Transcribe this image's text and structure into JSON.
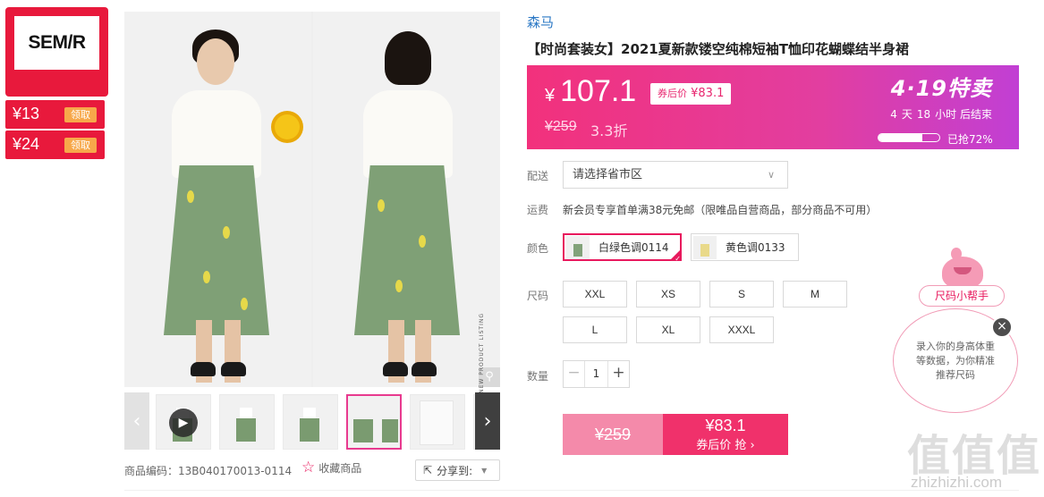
{
  "brand_box": {
    "logo_text": "SEM/R"
  },
  "coupons": [
    {
      "amount": "¥13",
      "action": "领取"
    },
    {
      "amount": "¥24",
      "action": "领取"
    }
  ],
  "gallery": {
    "vertical_watermark": "NEW PRODUCT LISTING",
    "zoom_icon": "magnifier-icon",
    "thumbnails": [
      {
        "kind": "video",
        "icon": "play-icon"
      },
      {
        "kind": "image"
      },
      {
        "kind": "image"
      },
      {
        "kind": "image",
        "active": true
      },
      {
        "kind": "image"
      },
      {
        "kind": "image"
      }
    ],
    "prev_icon": "chevron-left-icon",
    "next_icon": "chevron-right-icon"
  },
  "product": {
    "brand": "森马",
    "title": "【时尚套装女】2021夏新款镂空纯棉短袖T恤印花蝴蝶结半身裙",
    "sku_label": "商品编码：",
    "sku_value": "13B040170013-0114",
    "favorite_label": "收藏商品",
    "share_label": "分享到:"
  },
  "price": {
    "currency": "¥",
    "current": "107.1",
    "after_coupon_label": "券后价",
    "after_coupon_value": "¥83.1",
    "original": "¥259",
    "discount": "3.3折",
    "promo_name": "4·19特卖",
    "countdown": {
      "days": "4",
      "days_unit": "天",
      "hours": "18",
      "hours_unit": "小时",
      "suffix": "后结束"
    },
    "sold_percent": 72,
    "sold_text": "已抢72%",
    "accent_color": "#f2317c"
  },
  "delivery": {
    "label": "配送",
    "placeholder": "请选择省市区"
  },
  "shipping": {
    "label": "运费",
    "text": "新会员专享首单满38元免邮（限唯品自营商品，部分商品不可用）"
  },
  "colors": {
    "label": "颜色",
    "options": [
      {
        "name": "白绿色调0114",
        "selected": true
      },
      {
        "name": "黄色调0133",
        "selected": false
      }
    ]
  },
  "sizes": {
    "label": "尺码",
    "options": [
      "XXL",
      "XS",
      "S",
      "M",
      "L",
      "XL",
      "XXXL"
    ]
  },
  "quantity": {
    "label": "数量",
    "value": "1",
    "minus": "−",
    "plus": "+"
  },
  "buy": {
    "original": "¥259",
    "price": "¥83.1",
    "label": "券后价 抢 ›"
  },
  "helper": {
    "pill": "尺码小帮手",
    "text": "录入你的身高体重等数据，为你精准推荐尺码",
    "close": "×"
  },
  "watermark": {
    "title": "值值值",
    "url": "zhizhizhi.com"
  }
}
